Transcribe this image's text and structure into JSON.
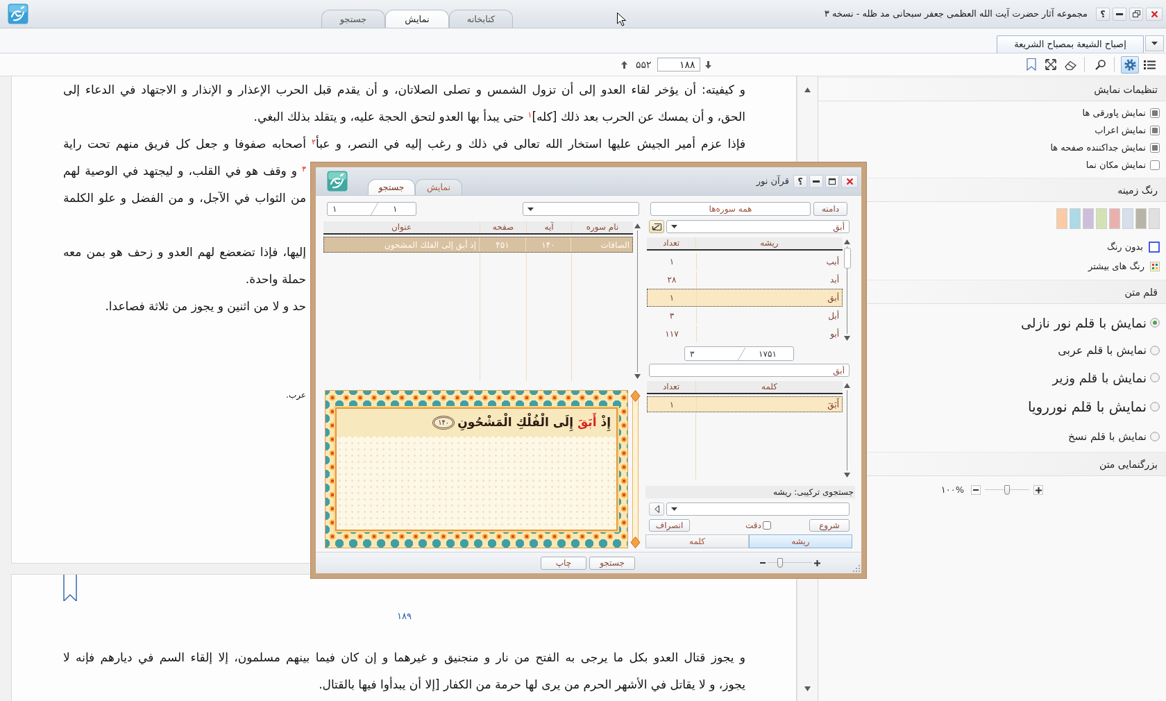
{
  "window": {
    "title": "مجموعه آثار حضرت آیت الله العظمی جعفر سبحانی مد ظله - نسخه ۳",
    "help_label": "؟"
  },
  "main_tabs": [
    {
      "label": "کتابخانه",
      "selected": false
    },
    {
      "label": "نمایش",
      "selected": true
    },
    {
      "label": "جستجو",
      "selected": false
    }
  ],
  "document_tabs": [
    {
      "label": "إصباح الشيعة بمصباح الشريعة",
      "selected": true
    }
  ],
  "toolbar": {
    "page_total": "۵۵۲",
    "page_current": "۱۸۸",
    "tools": [
      {
        "kind": "list",
        "selected": false
      },
      {
        "kind": "settings",
        "selected": true
      },
      {
        "kind": "search",
        "selected": false
      },
      {
        "kind": "eraser",
        "selected": false
      },
      {
        "kind": "fullscreen",
        "selected": false
      },
      {
        "kind": "bookmark",
        "selected": false
      }
    ]
  },
  "document": {
    "pages": [
      {
        "lines": [
          {
            "kind": "full",
            "text": "و كيفيته: أن يؤخر لقاء العدو إلى أن تزول الشمس و تصلى الصلاتان، و أن يقدم قبل الحرب الإعذار و الإنذار و الاجتهاد في الدعاء إلى"
          },
          {
            "kind": "end",
            "text": "الحق، و أن يمسك عن الحرب بعد ذلك [كله]$^{۱}$ حتى يبدأ بها العدو لتحق الحجة عليه، و يتقلد بذلك البغي."
          },
          {
            "kind": "full",
            "text": "فإذا عزم أمير الجيش عليها استخار الله تعالى في ذلك و رغب إليه في النصر، و عبأ$^{۲}$ أصحابه صفوفا و جعل كل فريق منهم تحت راية"
          },
          {
            "kind": "clipped",
            "text": "$^{۳}$ و وقف هو في القلب، و ليجتهد في الوصية لهم"
          },
          {
            "kind": "clipped",
            "text": "من الثواب في الآجل، و من الفضل و علو الكلمة"
          },
          {
            "kind": "clipped",
            "text": "إليها، فإذا تضعضع لهم العدو و زحف هو بمن معه"
          },
          {
            "kind": "clipped_end",
            "text": "حملة واحدة."
          },
          {
            "kind": "clipped_end",
            "text": "حد و لا من اثنين و يجوز من ثلاثة فصاعدا."
          }
        ],
        "footnote": "عرب."
      },
      {
        "bookmarked": true,
        "page_number": "۱۸۹",
        "lines": [
          {
            "kind": "full",
            "text": "و يجوز قتال العدو بكل ما يرجى به الفتح من نار و منجنيق و غيرهما و إن كان فيما بينهم مسلمون، إلا إلقاء السم في ديارهم فإنه لا"
          },
          {
            "kind": "end",
            "text": "يجوز، و لا يقاتل في الأشهر الحرم من يرى لها حرمة من الكفار [إلا أن يبدأوا فيها بالقتال."
          }
        ]
      }
    ]
  },
  "settings_panel": {
    "sections": [
      {
        "kind": "checks",
        "title": "تنظیمات نمایش",
        "items": [
          {
            "label": "نمایش پاورقی ها",
            "checked": true
          },
          {
            "label": "نمایش اعراب",
            "checked": true
          },
          {
            "label": "نمایش جداکننده صفحه ها",
            "checked": true
          },
          {
            "label": "نمایش مکان نما",
            "checked": false
          }
        ]
      },
      {
        "kind": "colors",
        "title": "رنگ زمینه",
        "swatches": [
          {
            "color": "#e0e0e0"
          },
          {
            "color": "#b8b5a8"
          },
          {
            "color": "#d6dfeb"
          },
          {
            "color": "#eab0b0"
          },
          {
            "color": "#d3e2b3"
          },
          {
            "color": "#cdbfdc"
          },
          {
            "color": "#acdae6"
          },
          {
            "color": "#fccaa5"
          }
        ],
        "options": [
          {
            "kind": "none",
            "label": "بدون رنگ"
          },
          {
            "kind": "more",
            "label": "رنگ های بیشتر"
          }
        ]
      },
      {
        "kind": "fonts",
        "title": "قلم متن",
        "items": [
          {
            "label": "نمایش با قلم نور نازلی",
            "selected": true
          },
          {
            "label": "نمایش با قلم عربی",
            "selected": false
          },
          {
            "label": "نمایش با قلم وزیر",
            "selected": false
          },
          {
            "label": "نمایش با قلم نوررویا",
            "selected": false
          },
          {
            "label": "نمایش با قلم نسخ",
            "selected": false
          }
        ]
      },
      {
        "kind": "zoom",
        "title": "بزرگنمایی متن",
        "reading": "۱۰۰%",
        "level": 0.5
      }
    ]
  },
  "quran_dialog": {
    "title": "قرآن نور",
    "help_label": "؟",
    "tabs": [
      {
        "label": "نمایش",
        "selected": false
      },
      {
        "label": "جستجو",
        "selected": true
      }
    ],
    "results": {
      "pager": [
        "۱",
        "۱"
      ],
      "columns": [
        "نام سوره",
        "آیه",
        "صفحه",
        "عنوان"
      ],
      "rows": [
        {
          "cells": [
            "الصافات",
            "۱۴۰",
            "۴۵۱",
            "إذ أبق إلى الفلك المشحون"
          ],
          "selected": true
        }
      ]
    },
    "verse": {
      "text": "إِذْ **أَبَقَ** إِلَى الْفُلْكِ الْمَشْحُونِ",
      "number": "۱۴۰"
    },
    "search_button": "جستجو",
    "print_button": "چاپ",
    "zoom": {
      "level": 0.25
    },
    "search_panel": {
      "scope_button": "دامنه",
      "scope": "همه سوره‌ها",
      "root_query": "أبق",
      "roots": {
        "columns": [
          "ریشه",
          "تعداد"
        ],
        "rows": [
          {
            "cells": [
              "أبب",
              "۱"
            ],
            "selected": false
          },
          {
            "cells": [
              "أبد",
              "۲۸"
            ],
            "selected": false
          },
          {
            "cells": [
              "أبق",
              "۱"
            ],
            "selected": true
          },
          {
            "cells": [
              "أبل",
              "۳"
            ],
            "selected": false
          },
          {
            "cells": [
              "أبو",
              "۱۱۷"
            ],
            "selected": false
          }
        ]
      },
      "roots_pager": [
        "۱۷۵۱",
        "۳"
      ],
      "word_query": "أبق",
      "words": {
        "columns": [
          "کلمه",
          "تعداد"
        ],
        "rows": [
          {
            "cells": [
              "أَبَقَ",
              "۱"
            ],
            "selected": true
          }
        ]
      },
      "combined_label": "جستجوی ترکیبی: ریشه",
      "start_button": "شروع",
      "exact": {
        "label": "دقت",
        "checked": false
      },
      "cancel_button": "انصراف",
      "mode_tabs": [
        {
          "label": "ریشه",
          "selected": true
        },
        {
          "label": "کلمه",
          "selected": false
        }
      ]
    }
  }
}
